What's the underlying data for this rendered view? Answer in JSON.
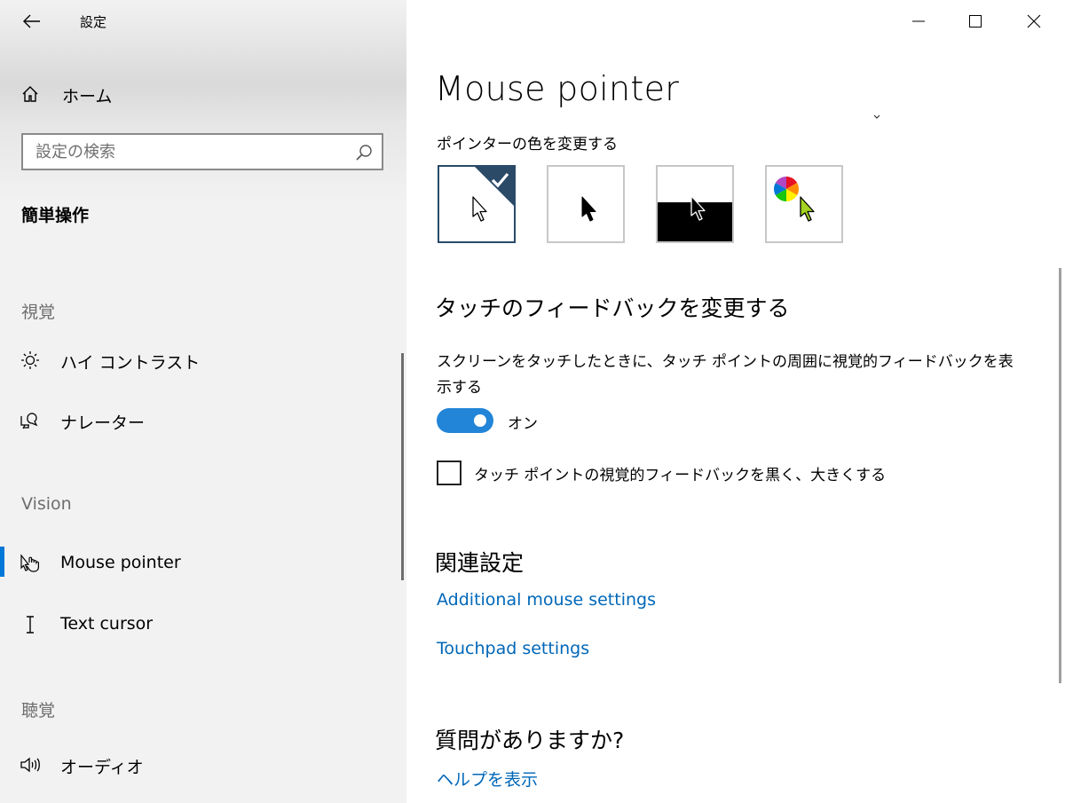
{
  "window": {
    "app_title": "設定"
  },
  "sidebar": {
    "home_label": "ホーム",
    "search_placeholder": "設定の検索",
    "category_title": "簡単操作",
    "sections": [
      {
        "label": "視覚",
        "items": [
          {
            "label": "ハイ コントラスト",
            "icon": "sun-icon"
          },
          {
            "label": "ナレーター",
            "icon": "narrator-icon"
          }
        ]
      },
      {
        "label": "Vision",
        "items": [
          {
            "label": "Mouse pointer",
            "icon": "mouse-pointer-icon",
            "selected": true
          },
          {
            "label": "Text cursor",
            "icon": "text-cursor-icon"
          }
        ]
      },
      {
        "label": "聴覚",
        "items": [
          {
            "label": "オーディオ",
            "icon": "speaker-icon"
          }
        ]
      }
    ]
  },
  "main": {
    "page_title": "Mouse pointer",
    "pointer_color": {
      "label": "ポインターの色を変更する",
      "options": [
        {
          "name": "white-pointer",
          "selected": true
        },
        {
          "name": "black-pointer",
          "selected": false
        },
        {
          "name": "inverted-pointer",
          "selected": false
        },
        {
          "name": "custom-color-pointer",
          "selected": false
        }
      ],
      "custom_color": "#a4d321"
    },
    "touch_feedback": {
      "heading": "タッチのフィードバックを変更する",
      "description": "スクリーンをタッチしたときに、タッチ ポイントの周囲に視覚的フィードバックを表示する",
      "toggle_state": "オン",
      "toggle_on": true,
      "checkbox_label": "タッチ ポイントの視覚的フィードバックを黒く、大きくする",
      "checkbox_checked": false
    },
    "related": {
      "heading": "関連設定",
      "links": [
        "Additional mouse settings",
        "Touchpad settings"
      ]
    },
    "help": {
      "heading": "質問がありますか?",
      "link": "ヘルプを表示"
    }
  },
  "colors": {
    "accent": "#0078d7",
    "toggle_on": "#2285d8",
    "link": "#0067b8",
    "selected_border": "#2a4a68"
  }
}
